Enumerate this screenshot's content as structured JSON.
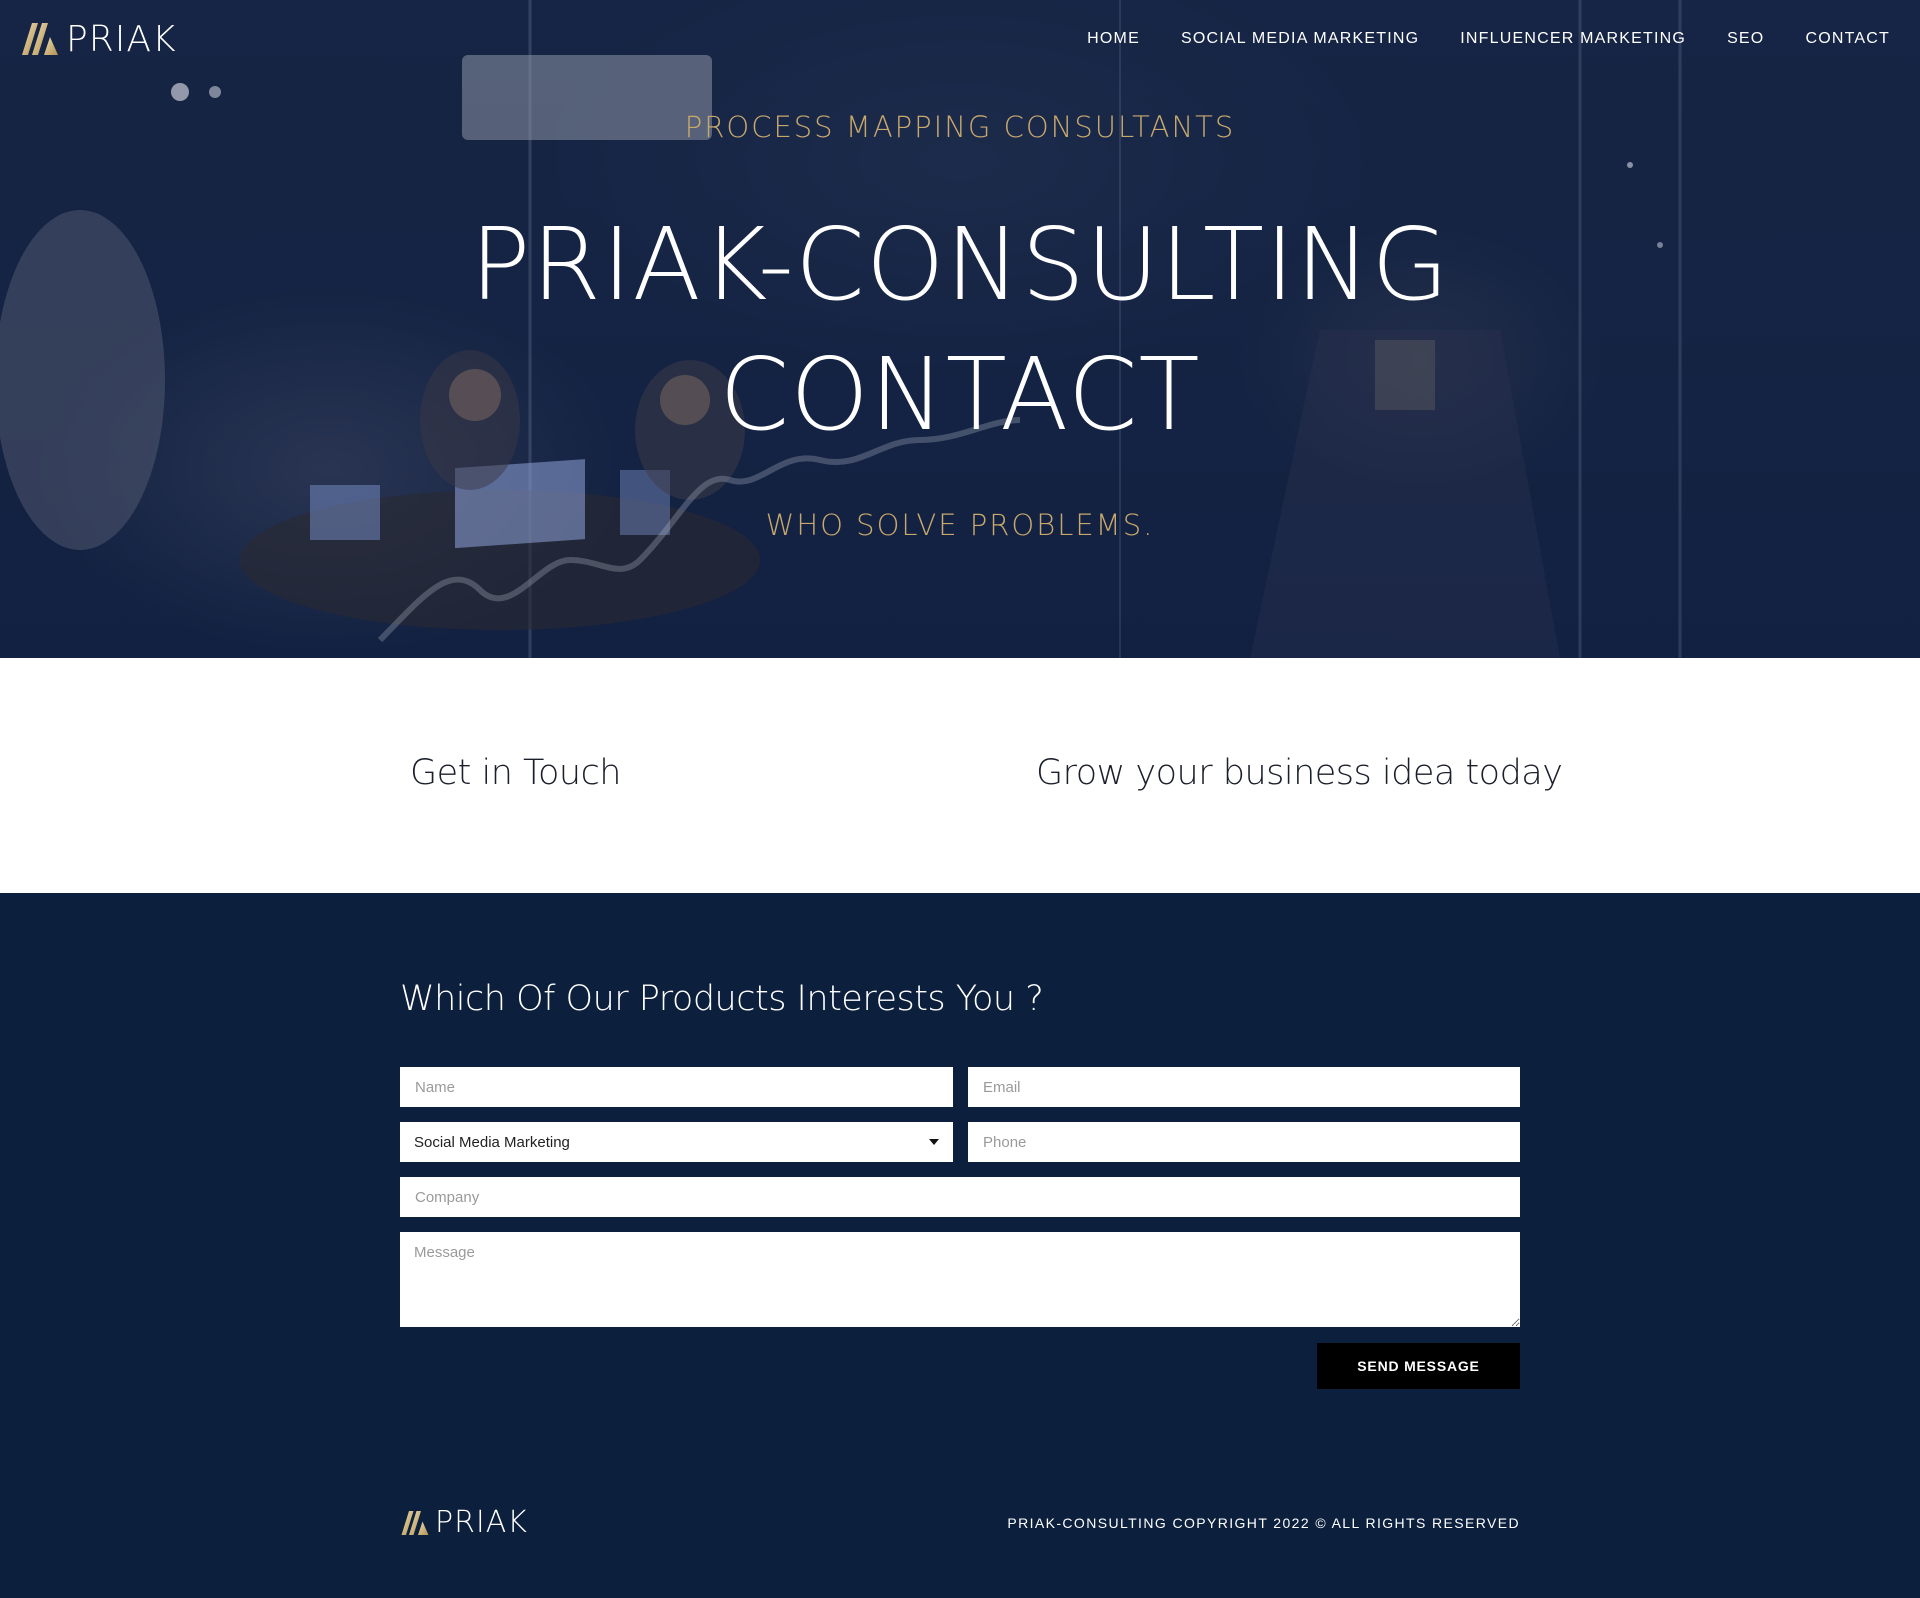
{
  "brand": {
    "name": "PRIAK",
    "accent_gold": "#c8a86d",
    "navy": "#0c1f3d"
  },
  "nav": {
    "items": [
      {
        "label": "HOME"
      },
      {
        "label": "SOCIAL MEDIA MARKETING"
      },
      {
        "label": "INFLUENCER MARKETING"
      },
      {
        "label": "SEO"
      },
      {
        "label": "CONTACT"
      }
    ]
  },
  "hero": {
    "eyebrow": "PROCESS MAPPING CONSULTANTS",
    "title_line1": "PRIAK-CONSULTING",
    "title_line2": "CONTACT",
    "subtitle": "WHO SOLVE PROBLEMS."
  },
  "intro": {
    "left_heading": "Get in Touch",
    "right_heading": "Grow your business idea today"
  },
  "form": {
    "heading": "Which Of Our Products Interests You ?",
    "name_placeholder": "Name",
    "email_placeholder": "Email",
    "product_selected": "Social Media Marketing",
    "phone_placeholder": "Phone",
    "company_placeholder": "Company",
    "message_placeholder": "Message",
    "submit_label": "SEND MESSAGE"
  },
  "footer": {
    "copyright": "PRIAK-CONSULTING COPYRIGHT 2022 © ALL RIGHTS RESERVED"
  }
}
